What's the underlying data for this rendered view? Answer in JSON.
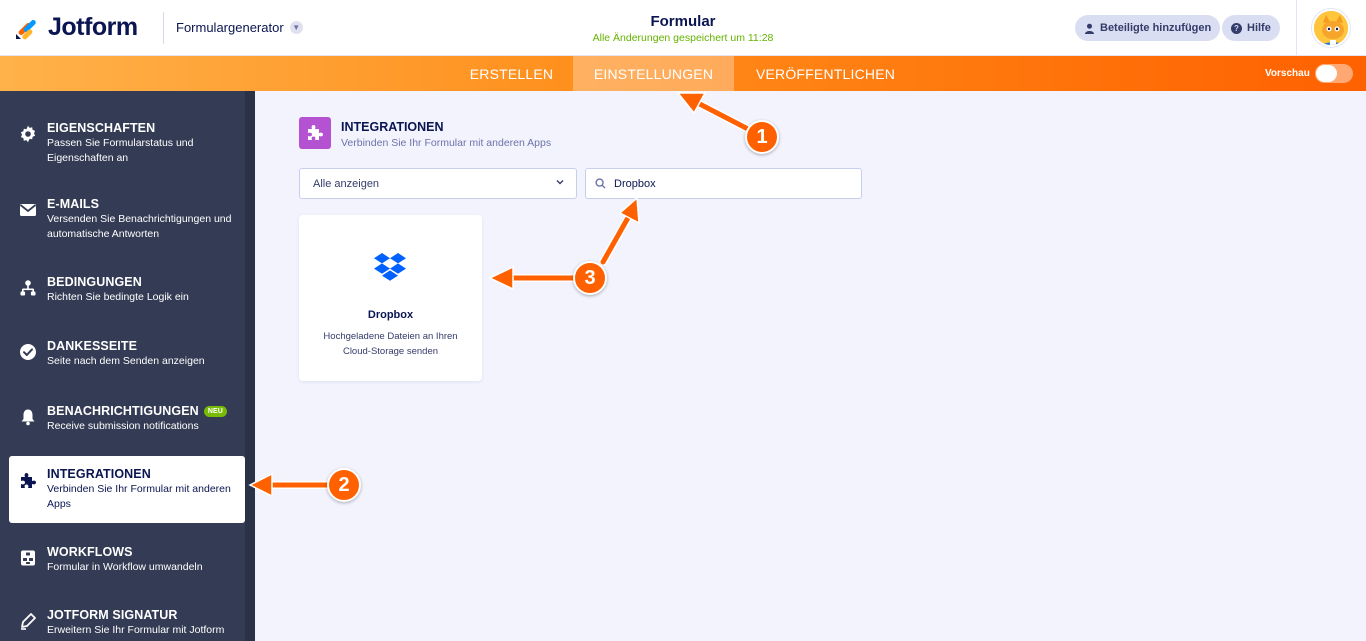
{
  "header": {
    "brand": "Jotform",
    "form_builder_label": "Formulargenerator",
    "form_title": "Formular",
    "saved_status": "Alle Änderungen gespeichert um 11:28",
    "add_collaborators": "Beteiligte hinzufügen",
    "help": "Hilfe"
  },
  "nav": {
    "tabs": [
      {
        "label": "ERSTELLEN",
        "active": false
      },
      {
        "label": "EINSTELLUNGEN",
        "active": true
      },
      {
        "label": "VERÖFFENTLICHEN",
        "active": false
      }
    ],
    "preview_label": "Vorschau",
    "preview_on": false
  },
  "sidebar": {
    "items": [
      {
        "title": "EIGENSCHAFTEN",
        "desc": "Passen Sie Formularstatus und Eigenschaften an",
        "icon": "gear-icon"
      },
      {
        "title": "E-MAILS",
        "desc": "Versenden Sie Benachrichtigungen und automatische Antworten",
        "icon": "envelope-icon"
      },
      {
        "title": "BEDINGUNGEN",
        "desc": "Richten Sie bedingte Logik ein",
        "icon": "hierarchy-icon"
      },
      {
        "title": "DANKESSEITE",
        "desc": "Seite nach dem Senden anzeigen",
        "icon": "check-circle-icon"
      },
      {
        "title": "BENACHRICHTIGUNGEN",
        "badge": "NEU",
        "desc": "Receive submission notifications",
        "icon": "bell-icon"
      },
      {
        "title": "INTEGRATIONEN",
        "desc": "Verbinden Sie Ihr Formular mit anderen Apps",
        "icon": "puzzle-icon",
        "active": true
      },
      {
        "title": "WORKFLOWS",
        "desc": "Formular in Workflow umwandeln",
        "icon": "workflow-icon"
      },
      {
        "title": "JOTFORM SIGNATUR",
        "desc": "Erweitern Sie Ihr Formular mit Jotform",
        "icon": "pen-icon"
      }
    ]
  },
  "main": {
    "section_title": "INTEGRATIONEN",
    "section_subtitle": "Verbinden Sie Ihr Formular mit anderen Apps",
    "filter_value": "Alle anzeigen",
    "search_value": "Dropbox",
    "results": [
      {
        "name": "Dropbox",
        "desc": "Hochgeladene Dateien an Ihren Cloud-Storage senden",
        "icon": "dropbox-icon"
      }
    ]
  },
  "annotations": {
    "markers": [
      "1",
      "2",
      "3"
    ],
    "color": "#ff6100"
  },
  "colors": {
    "accent_orange": "#ff6100",
    "sidebar_bg": "#343b54",
    "integration_purple": "#b452d1",
    "dropbox_blue": "#0061fe",
    "saved_green": "#64b200"
  }
}
